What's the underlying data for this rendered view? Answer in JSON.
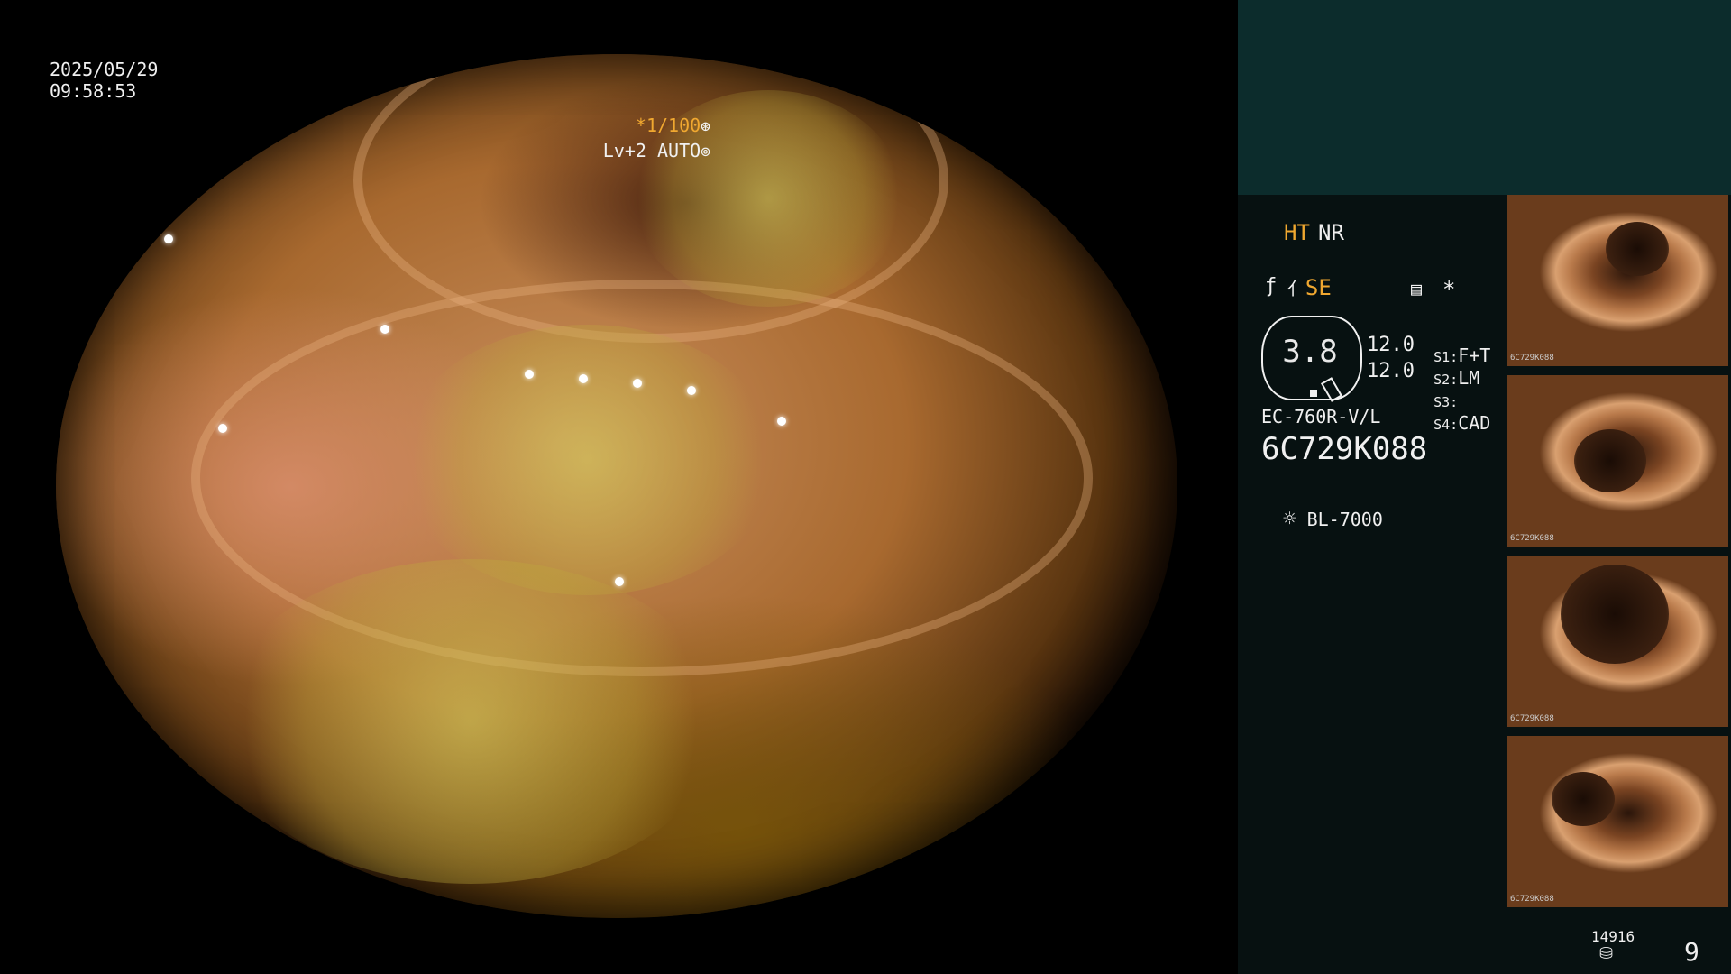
{
  "overlay": {
    "date": "2025/05/29",
    "time": "09:58:53",
    "shutter": "*1/100",
    "shutter_icon": "aperture-icon",
    "level": "Lv+2 AUTO",
    "level_icon": "iris-icon"
  },
  "panel": {
    "ht": "HT",
    "nr": "NR",
    "se": "SE",
    "se_icon": "fan-icon",
    "f_icon": "f-icon",
    "menu_icon": "menu-icon",
    "star": "*",
    "gauge_value": "3.8",
    "gauge_left": "12.0",
    "gauge_right": "12.0",
    "s1_label": "S1:",
    "s1_value": "F+T",
    "s2_label": "S2:",
    "s2_value": "LM",
    "s3_label": "S3:",
    "s3_value": "",
    "s4_label": "S4:",
    "s4_value": "CAD",
    "scope_model": "EC-760R-V/L",
    "scope_serial": "6C729K088",
    "light_source_icon": "lamp-icon",
    "light_source": "BL-7000",
    "counter": "14916",
    "counter_icon": "database-icon",
    "page": "9"
  },
  "thumbnails": [
    {
      "caption": "6C729K088"
    },
    {
      "caption": "6C729K088"
    },
    {
      "caption": "6C729K088"
    },
    {
      "caption": "6C729K088"
    }
  ],
  "colors": {
    "accent": "#f0a830",
    "panel_bg": "#071111",
    "panel_top": "#0c2c2c"
  }
}
